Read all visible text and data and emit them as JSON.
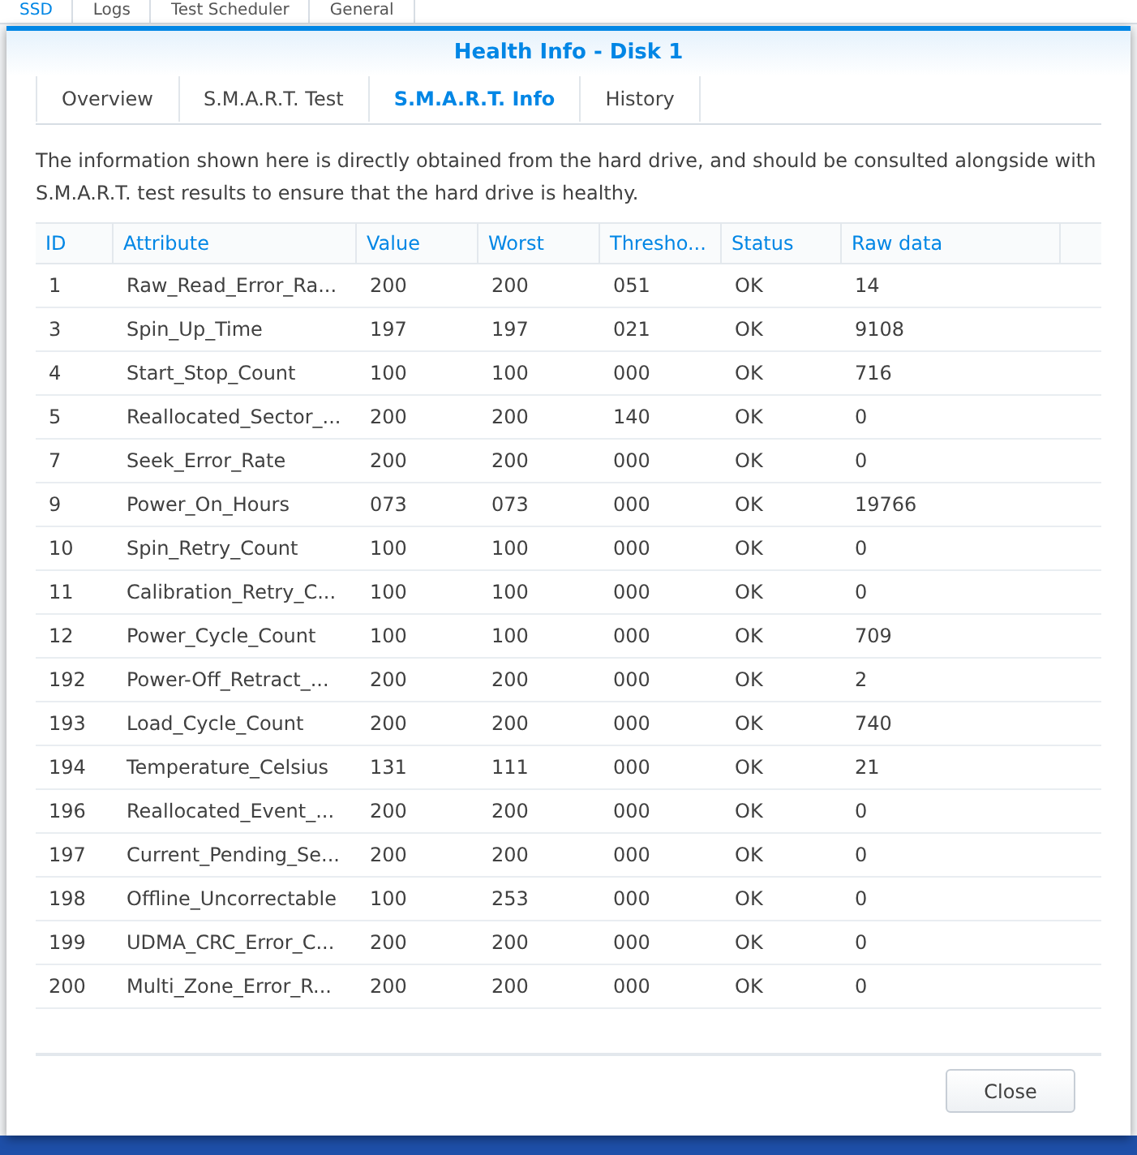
{
  "background_tabs": [
    {
      "label": "SSD",
      "selected": true
    },
    {
      "label": "Logs",
      "selected": false
    },
    {
      "label": "Test Scheduler",
      "selected": false
    },
    {
      "label": "General",
      "selected": false
    }
  ],
  "dialog": {
    "title": "Health Info - Disk 1",
    "tabs": [
      {
        "label": "Overview",
        "selected": false
      },
      {
        "label": "S.M.A.R.T. Test",
        "selected": false
      },
      {
        "label": "S.M.A.R.T. Info",
        "selected": true
      },
      {
        "label": "History",
        "selected": false
      }
    ],
    "description": "The information shown here is directly obtained from the hard drive, and should be consulted alongside with S.M.A.R.T. test results to ensure that the hard drive is healthy.",
    "table": {
      "columns": [
        "ID",
        "Attribute",
        "Value",
        "Worst",
        "Thresho...",
        "Status",
        "Raw data"
      ],
      "rows": [
        [
          "1",
          "Raw_Read_Error_Ra...",
          "200",
          "200",
          "051",
          "OK",
          "14"
        ],
        [
          "3",
          "Spin_Up_Time",
          "197",
          "197",
          "021",
          "OK",
          "9108"
        ],
        [
          "4",
          "Start_Stop_Count",
          "100",
          "100",
          "000",
          "OK",
          "716"
        ],
        [
          "5",
          "Reallocated_Sector_...",
          "200",
          "200",
          "140",
          "OK",
          "0"
        ],
        [
          "7",
          "Seek_Error_Rate",
          "200",
          "200",
          "000",
          "OK",
          "0"
        ],
        [
          "9",
          "Power_On_Hours",
          "073",
          "073",
          "000",
          "OK",
          "19766"
        ],
        [
          "10",
          "Spin_Retry_Count",
          "100",
          "100",
          "000",
          "OK",
          "0"
        ],
        [
          "11",
          "Calibration_Retry_C...",
          "100",
          "100",
          "000",
          "OK",
          "0"
        ],
        [
          "12",
          "Power_Cycle_Count",
          "100",
          "100",
          "000",
          "OK",
          "709"
        ],
        [
          "192",
          "Power-Off_Retract_...",
          "200",
          "200",
          "000",
          "OK",
          "2"
        ],
        [
          "193",
          "Load_Cycle_Count",
          "200",
          "200",
          "000",
          "OK",
          "740"
        ],
        [
          "194",
          "Temperature_Celsius",
          "131",
          "111",
          "000",
          "OK",
          "21"
        ],
        [
          "196",
          "Reallocated_Event_...",
          "200",
          "200",
          "000",
          "OK",
          "0"
        ],
        [
          "197",
          "Current_Pending_Se...",
          "200",
          "200",
          "000",
          "OK",
          "0"
        ],
        [
          "198",
          "Offline_Uncorrectable",
          "100",
          "253",
          "000",
          "OK",
          "0"
        ],
        [
          "199",
          "UDMA_CRC_Error_C...",
          "200",
          "200",
          "000",
          "OK",
          "0"
        ],
        [
          "200",
          "Multi_Zone_Error_R...",
          "200",
          "200",
          "000",
          "OK",
          "0"
        ]
      ]
    },
    "buttons": [
      "Close"
    ]
  }
}
